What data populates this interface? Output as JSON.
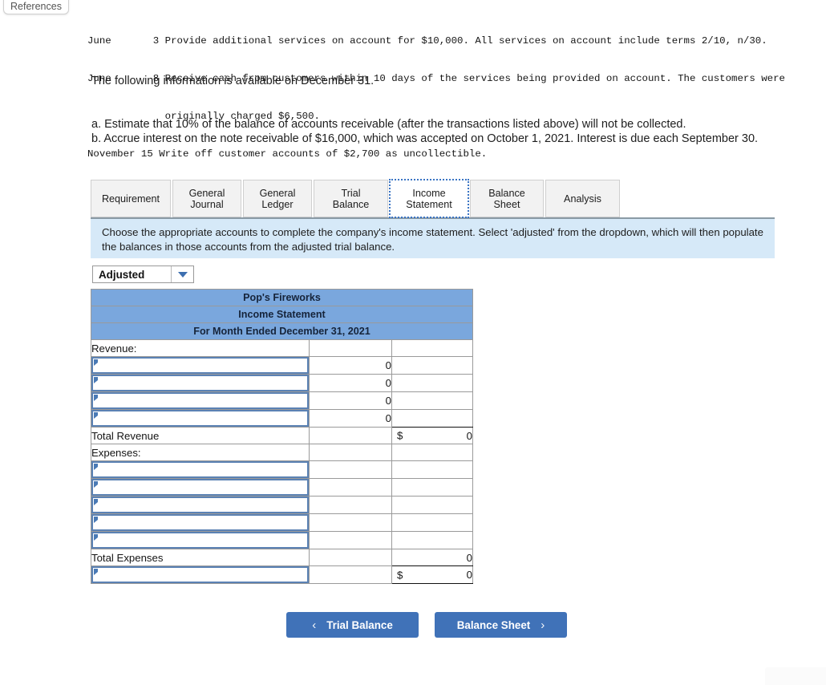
{
  "references_button": {
    "label": "References"
  },
  "transactions": {
    "lines": [
      "June       3 Provide additional services on account for $10,000. All services on account include terms 2/10, n/30.",
      "June       8 Receive cash from customers within 10 days of the services being provided on account. The customers were",
      "             originally charged $6,500.",
      "November 15 Write off customer accounts of $2,700 as uncollectible."
    ]
  },
  "intro_line": "The following information is available on December 31.",
  "requirements": {
    "a": "a. Estimate that 10% of the balance of accounts receivable (after the transactions listed above) will not be collected.",
    "b": "b. Accrue interest on the note receivable of $16,000, which was accepted on October 1, 2021. Interest is due each September 30."
  },
  "tabs": [
    {
      "label": "Requirement",
      "active": false
    },
    {
      "label": "General\nJournal",
      "active": false
    },
    {
      "label": "General\nLedger",
      "active": false
    },
    {
      "label": "Trial Balance",
      "active": false
    },
    {
      "label": "Income\nStatement",
      "active": true
    },
    {
      "label": "Balance Sheet",
      "active": false
    },
    {
      "label": "Analysis",
      "active": false
    }
  ],
  "instruction_banner": {
    "text": "Choose the appropriate accounts to complete the company's income statement. Select 'adjusted' from the dropdown, which will then populate the balances in those accounts from the adjusted trial balance."
  },
  "adjusted_dropdown": {
    "value": "Adjusted",
    "icon": "chevron-down-icon"
  },
  "statement": {
    "header_rows": [
      "Pop's Fireworks",
      "Income Statement",
      "For Month Ended December 31, 2021"
    ],
    "revenue_section_label": "Revenue:",
    "revenue_rows": [
      {
        "account": "",
        "mid": "0",
        "right": ""
      },
      {
        "account": "",
        "mid": "0",
        "right": ""
      },
      {
        "account": "",
        "mid": "0",
        "right": ""
      },
      {
        "account": "",
        "mid": "0",
        "right": ""
      }
    ],
    "total_revenue": {
      "label": "Total Revenue",
      "mid": "",
      "symbol": "$",
      "right": "0"
    },
    "expenses_section_label": "Expenses:",
    "expense_rows": [
      {
        "account": "",
        "mid": "",
        "right": ""
      },
      {
        "account": "",
        "mid": "",
        "right": ""
      },
      {
        "account": "",
        "mid": "",
        "right": ""
      },
      {
        "account": "",
        "mid": "",
        "right": ""
      },
      {
        "account": "",
        "mid": "",
        "right": ""
      }
    ],
    "total_expenses": {
      "label": "Total Expenses",
      "mid": "",
      "right": "0"
    },
    "net_income": {
      "account": "",
      "mid": "",
      "symbol": "$",
      "right": "0"
    }
  },
  "nav": {
    "prev_label": "Trial Balance",
    "prev_icon": "chevron-left-icon",
    "next_label": "Balance Sheet",
    "next_icon": "chevron-right-icon"
  },
  "colors": {
    "banner_bg": "#d6e9f8",
    "table_header_bg": "#7aa7dd",
    "accent_blue": "#4072b8",
    "input_border": "#5b82b4"
  }
}
